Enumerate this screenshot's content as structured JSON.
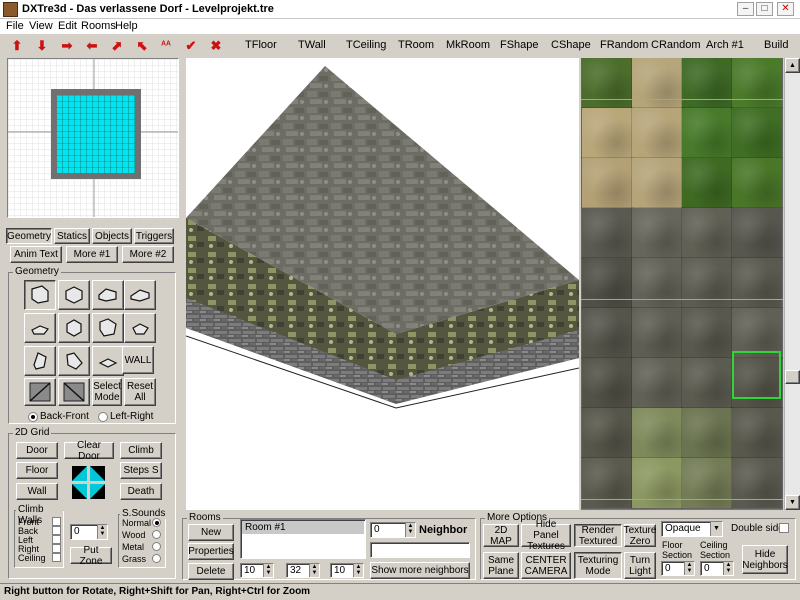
{
  "window": {
    "title": "DXTre3d - Das verlassene Dorf - Levelprojekt.tre",
    "min": "–",
    "max": "□",
    "close": "✕"
  },
  "menu": [
    "File",
    "View",
    "Edit",
    "Rooms",
    "Help"
  ],
  "toolbar": {
    "icons": [
      "arrow-up-icon",
      "arrow-down-icon",
      "arrow-right-icon",
      "arrow-left-icon",
      "arrow-diag-up-icon",
      "arrow-diag-left-icon",
      "letters-aa-icon",
      "checkmark-icon",
      "cross-icon"
    ],
    "glyphs": [
      "⬆",
      "⬇",
      "➡",
      "⬅",
      "⬈",
      "⬉",
      "ᴬᴬ",
      "✔",
      "✖"
    ],
    "buttons": [
      "TFloor",
      "TWall",
      "TCeiling",
      "TRoom",
      "MkRoom",
      "FShape",
      "CShape",
      "FRandom",
      "CRandom",
      "Arch #1",
      "Build"
    ]
  },
  "tabs": {
    "row1": [
      "Geometry",
      "Statics",
      "Objects",
      "Triggers"
    ],
    "row2": [
      "Anim Text",
      "More #1",
      "More #2"
    ]
  },
  "geometry": {
    "label": "Geometry",
    "wall": "WALL",
    "select_mode": "Select Mode",
    "reset_all": "Reset All",
    "radio_back_front": "Back-Front",
    "radio_left_right": "Left-Right"
  },
  "grid2d": {
    "label": "2D Grid",
    "door": "Door",
    "clear_door": "Clear Door",
    "climb": "Climb",
    "floor": "Floor",
    "steps": "Steps S",
    "wall": "Wall",
    "death": "Death"
  },
  "climb_walls": {
    "label": "Climb Walls",
    "items": [
      "Front",
      "Back",
      "Left",
      "Right",
      "Ceiling"
    ],
    "value": "0",
    "put_zone": "Put Zone"
  },
  "sounds": {
    "label": "S.Sounds",
    "items": [
      "Normal",
      "Wood",
      "Metal",
      "Grass"
    ],
    "selected": "Normal"
  },
  "rooms": {
    "label": "Rooms",
    "new": "New",
    "properties": "Properties",
    "delete": "Delete",
    "list": [
      "Room #1"
    ],
    "neighbor_value": "0",
    "neighbor_label": "Neighbor",
    "x": "10",
    "y": "32",
    "z": "10",
    "show_more": "Show more neighbors"
  },
  "more_options": {
    "label": "More Options",
    "map2d": "2D MAP",
    "hide_panel": "Hide Panel Textures",
    "render": "Render Textured",
    "texture_zero": "Texture Zero",
    "opacity": "Opaque",
    "double_side": "Double side",
    "same_plane": "Same Plane",
    "center_camera": "CENTER CAMERA",
    "texturing_mode": "Texturing Mode",
    "turn_light": "Turn Light",
    "floor_section": "Floor Section",
    "ceiling_section": "Ceiling Section",
    "floor_val": "0",
    "ceil_val": "0",
    "hide_neighbors": "Hide Neighbors"
  },
  "status": "Right button for Rotate,  Right+Shift for Pan, Right+Ctrl for Zoom",
  "colors": {
    "accent_cyan": "#00e5ef",
    "room_border": "#707070",
    "texture_highlight": "#31d43a"
  }
}
